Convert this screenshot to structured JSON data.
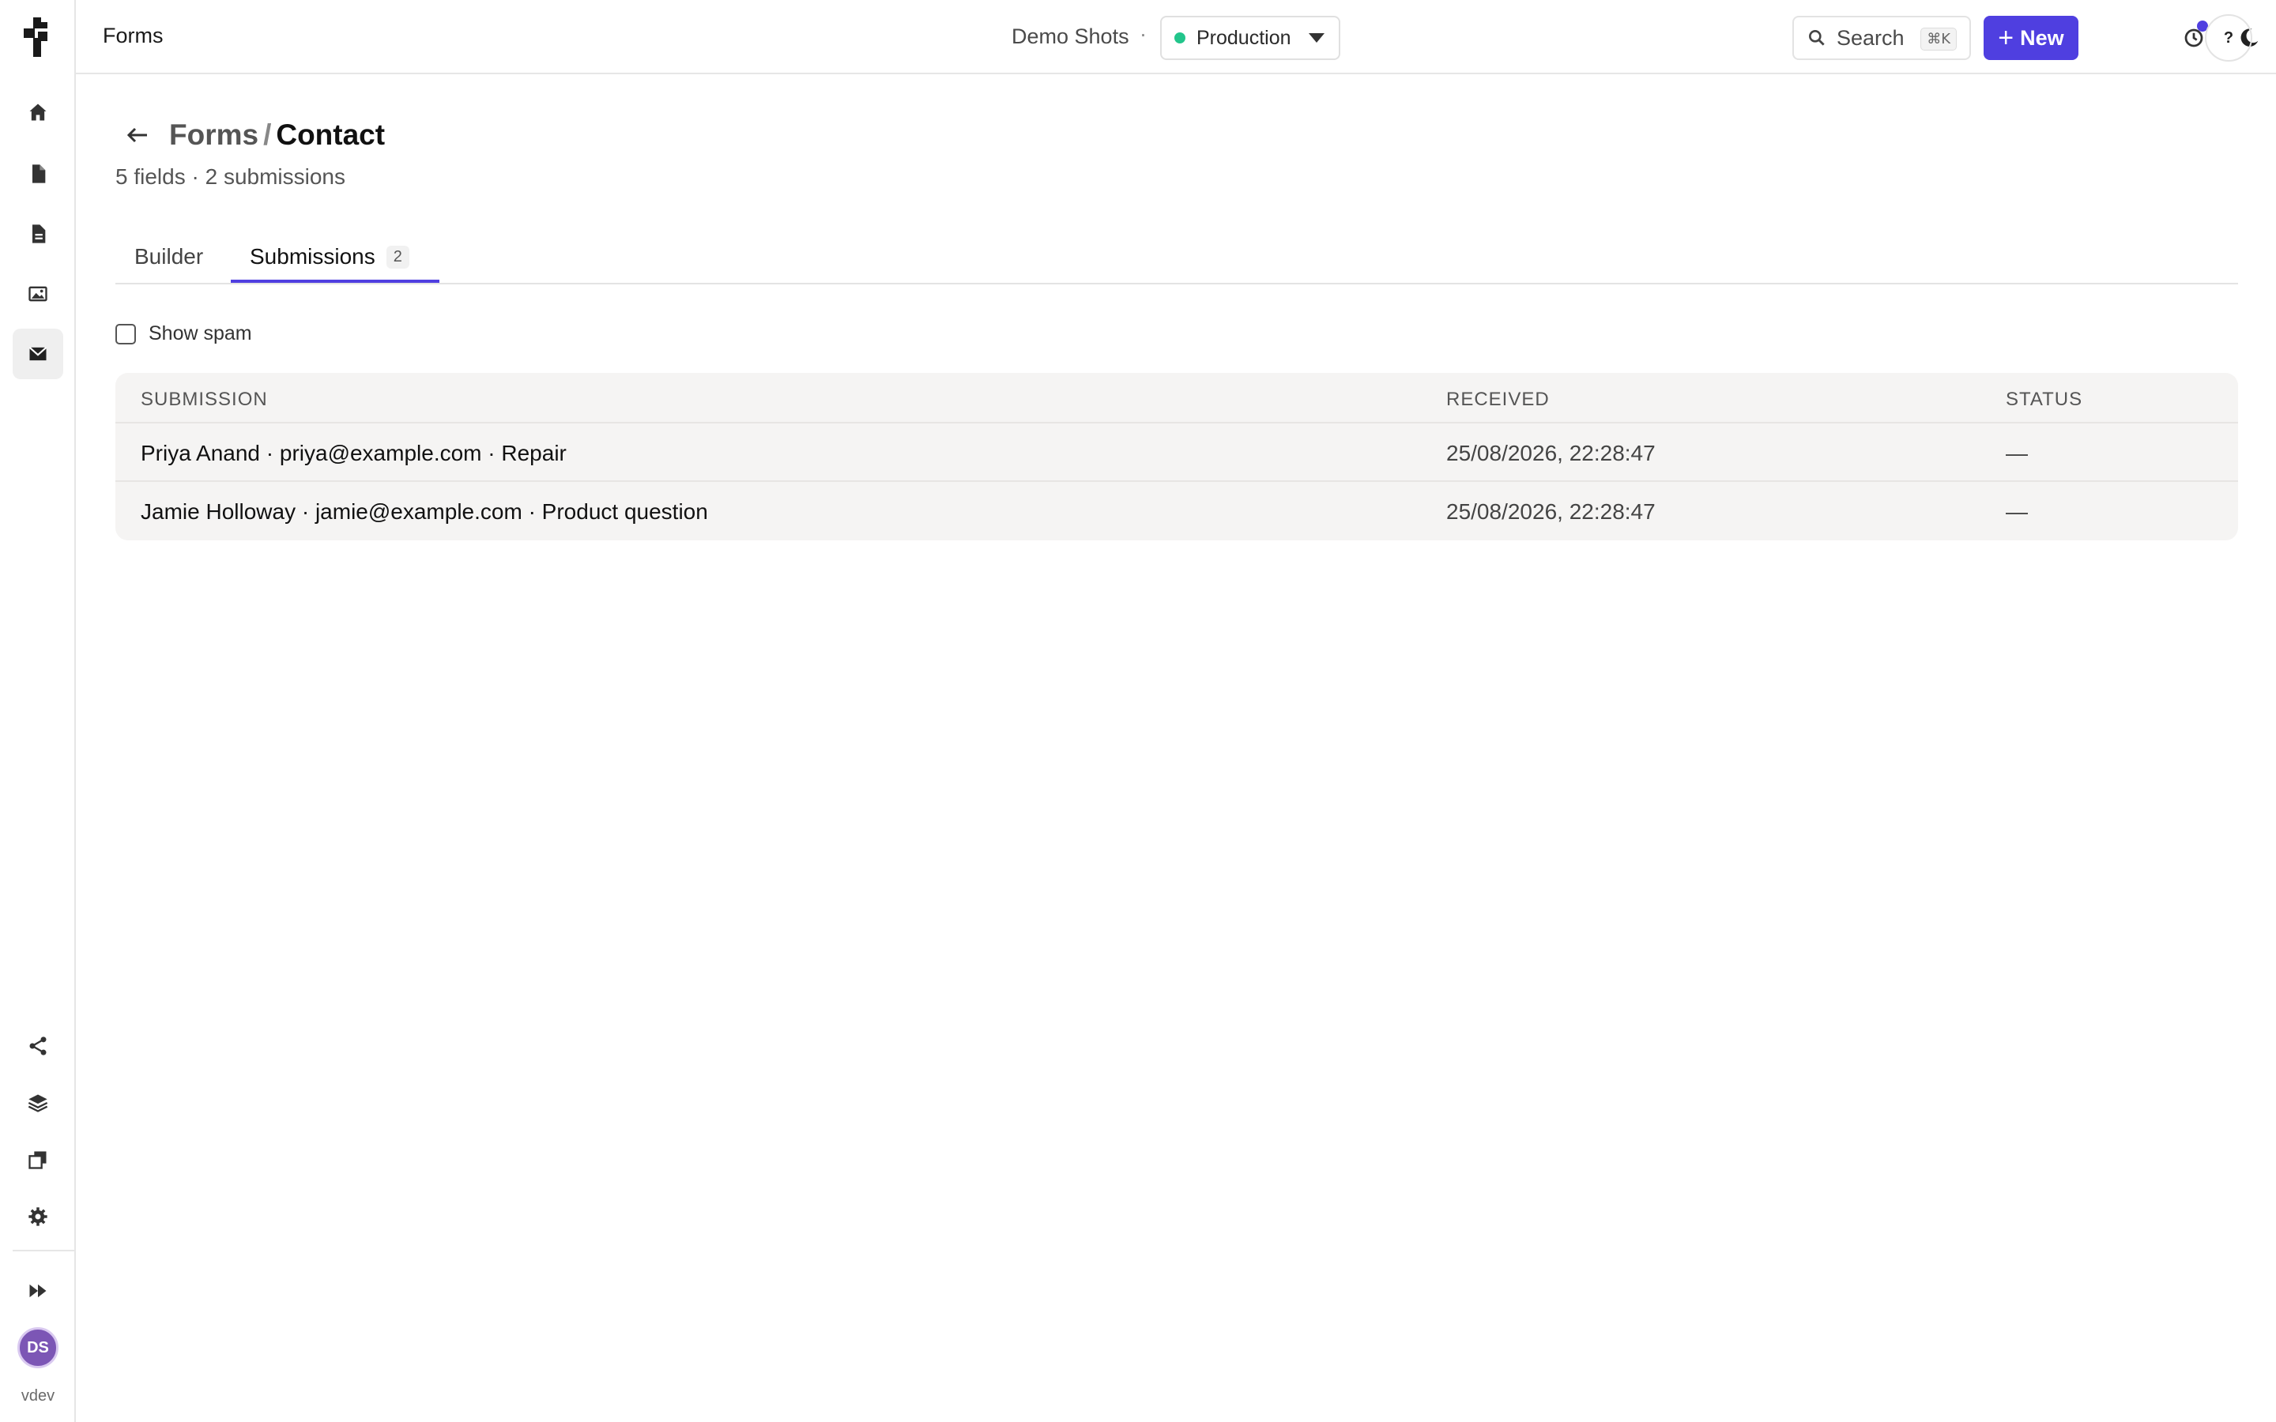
{
  "sidebar": {
    "logo": "brand-logo",
    "nav": [
      "home-icon",
      "page-icon",
      "document-icon",
      "image-icon",
      "mail-icon"
    ],
    "bottom": [
      "share-icon",
      "layers-icon",
      "copy-icon",
      "gear-icon",
      "fast-forward-icon"
    ],
    "avatar_initials": "DS",
    "version": "vdev"
  },
  "header": {
    "title": "Forms",
    "site_name": "Demo Shots",
    "site_separator": "·",
    "environment": "Production",
    "environment_color": "#22c58b",
    "search_label": "Search",
    "search_shortcut": "⌘K",
    "new_plus": "+",
    "new_label": "New",
    "accent_color": "#4f3fe0",
    "help_label": "?"
  },
  "page": {
    "breadcrumb_parent": "Forms",
    "breadcrumb_separator": "/",
    "breadcrumb_current": "Contact",
    "subtitle": "5 fields · 2 submissions"
  },
  "tabs": [
    {
      "label": "Builder",
      "active": false
    },
    {
      "label": "Submissions",
      "count": "2",
      "active": true
    }
  ],
  "filters": {
    "show_spam_label": "Show spam",
    "show_spam_checked": false
  },
  "table": {
    "columns": [
      "SUBMISSION",
      "RECEIVED",
      "STATUS"
    ],
    "rows": [
      {
        "submission": "Priya Anand · priya@example.com · Repair",
        "received": "25/08/2026, 22:28:47",
        "status": "—"
      },
      {
        "submission": "Jamie Holloway · jamie@example.com · Product question",
        "received": "25/08/2026, 22:28:47",
        "status": "—"
      }
    ]
  }
}
